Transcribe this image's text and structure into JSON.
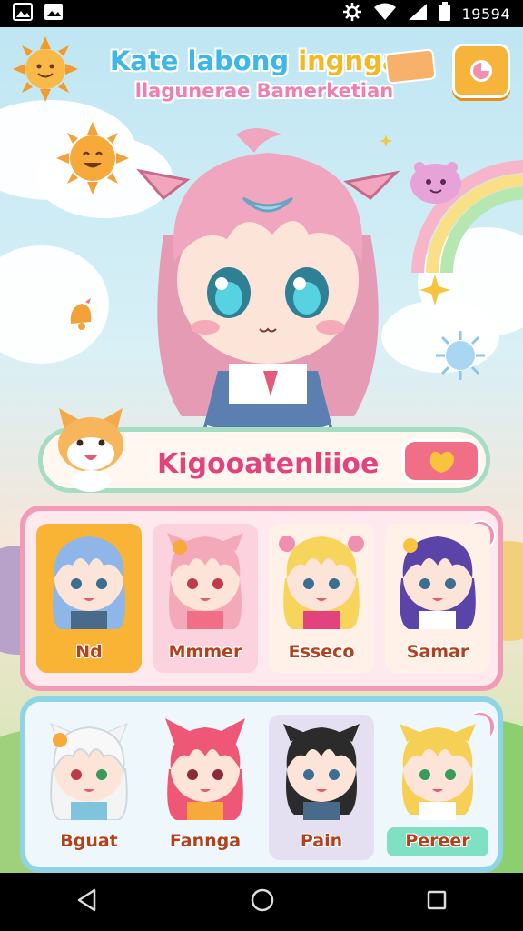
{
  "status_bar": {
    "time": "19594",
    "left_icons": [
      "image-icon",
      "photo-icon"
    ],
    "right_icons": [
      "settings-gear-icon",
      "wifi-icon",
      "signal-icon",
      "battery-icon"
    ]
  },
  "header": {
    "title_part1": "Kate labong",
    "title_part2": "ingngan",
    "subtitle": "llagunerae Bamerketian",
    "settings_icon": "settings-icon"
  },
  "main_character": {
    "description_hidden": false
  },
  "name_bar": {
    "name": "Kigooatenliioe",
    "button_icon": "heart-icon"
  },
  "roster_panels": [
    {
      "characters": [
        {
          "name": "Nd",
          "hair": "#8fb6e8",
          "selected": true
        },
        {
          "name": "Mmmer",
          "hair": "#f4a9b9",
          "selected": false
        },
        {
          "name": "Esseco",
          "hair": "#f7d45b",
          "selected": false
        },
        {
          "name": "Samar",
          "hair": "#5b44a8",
          "selected": false
        }
      ]
    },
    {
      "characters": [
        {
          "name": "Bguat",
          "hair": "#f4f4f4",
          "selected": false
        },
        {
          "name": "Fannga",
          "hair": "#ef5777",
          "selected": false
        },
        {
          "name": "Pain",
          "hair": "#2b2b2b",
          "selected": false
        },
        {
          "name": "Pereer",
          "hair": "#f6cf55",
          "selected": true
        }
      ]
    }
  ],
  "nav_bar": {
    "back_icon": "back-triangle-icon",
    "home_icon": "home-circle-icon",
    "recents_icon": "recents-square-icon"
  }
}
